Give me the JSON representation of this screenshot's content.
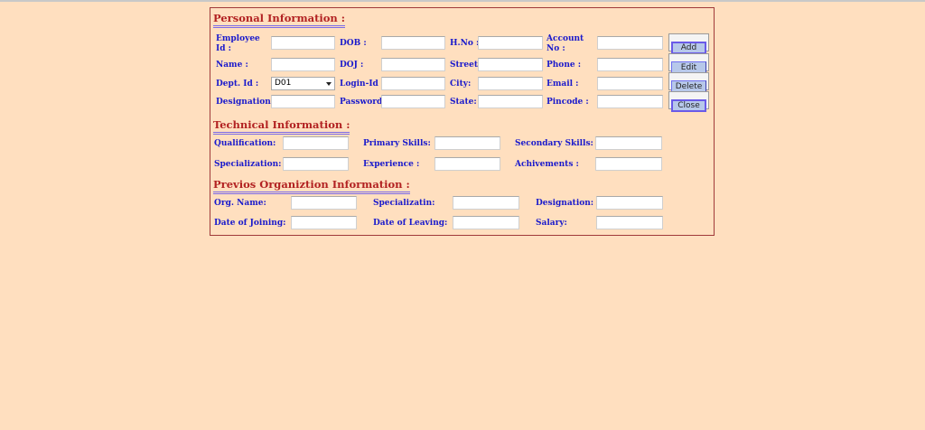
{
  "personal": {
    "title": "Personal Information :",
    "employee_id_label": "Employee Id :",
    "dob_label": "DOB :",
    "hno_label": "H.No :",
    "account_no_label": "Account No :",
    "name_label": "Name :",
    "doj_label": "DOJ :",
    "street_label": "Street:",
    "phone_label": "Phone :",
    "dept_id_label": "Dept. Id :",
    "dept_id_value": "D01",
    "login_id_label": "Login-Id :",
    "city_label": "City:",
    "email_label": "Email :",
    "designation_label": "Designation :",
    "password_label": "Password:",
    "state_label": "State:",
    "pincode_label": "Pincode :"
  },
  "buttons": {
    "add": "Add",
    "edit": "Edit",
    "delete": "Delete",
    "close": "Close"
  },
  "technical": {
    "title": "Technical Information :",
    "qualification_label": "Qualification:",
    "primary_skills_label": "Primary Skills:",
    "secondary_skills_label": "Secondary Skills:",
    "specialization_label": "Specialization:",
    "experience_label": "Experience :",
    "achievements_label": "Achivements :"
  },
  "previous": {
    "title": "Previos Organiztion Information :",
    "org_name_label": "Org. Name:",
    "specialization_label": "Specializatin:",
    "designation_label": "Designation:",
    "date_joining_label": "Date of Joining:",
    "date_leaving_label": "Date of Leaving:",
    "salary_label": "Salary:"
  }
}
